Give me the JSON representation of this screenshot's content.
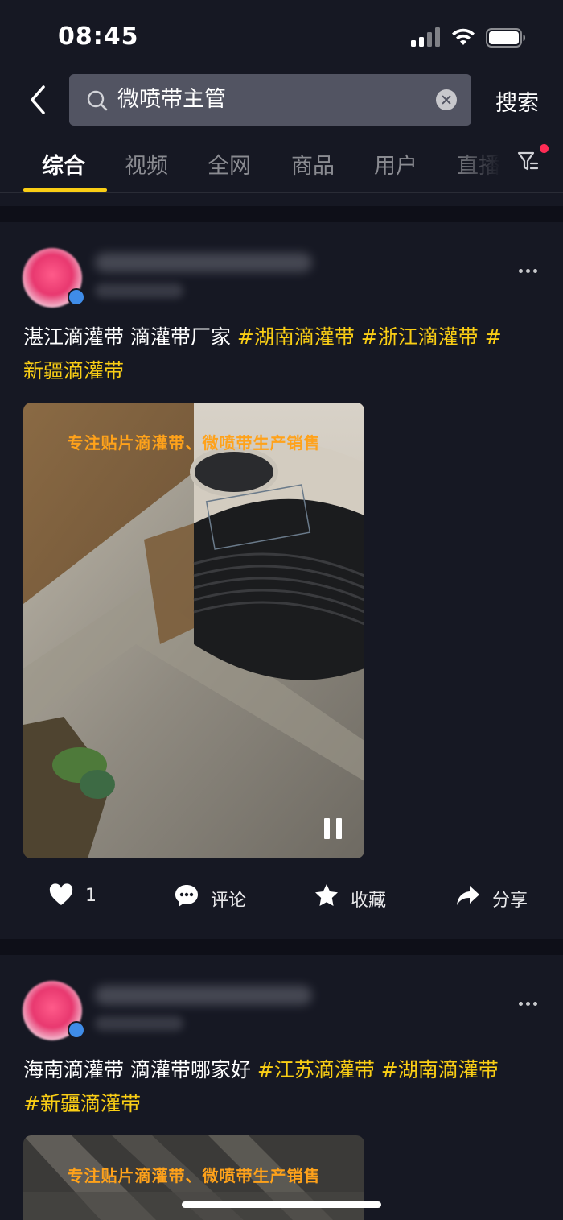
{
  "status_bar": {
    "time": "08:45"
  },
  "search": {
    "query": "微喷带主管",
    "button_label": "搜索"
  },
  "tabs": [
    {
      "label": "综合",
      "active": true
    },
    {
      "label": "视频",
      "active": false
    },
    {
      "label": "全网",
      "active": false
    },
    {
      "label": "商品",
      "active": false
    },
    {
      "label": "用户",
      "active": false
    },
    {
      "label": "直播",
      "active": false
    }
  ],
  "posts": [
    {
      "caption_text": "湛江滴灌带 滴灌带厂家 ",
      "hashtags": [
        "#湖南滴灌带",
        " #浙江滴灌带",
        " #",
        "新疆滴灌带"
      ],
      "video_overlay": "专注贴片滴灌带、微喷带生产销售",
      "actions": {
        "likes": "1",
        "comment": "评论",
        "favorite": "收藏",
        "share": "分享"
      }
    },
    {
      "caption_text": "海南滴灌带 滴灌带哪家好 ",
      "hashtags": [
        "#江苏滴灌带",
        " #湖南滴灌带",
        "#新疆滴灌带"
      ],
      "video_overlay": "专注贴片滴灌带、微喷带生产销售"
    }
  ],
  "colors": {
    "background": "#161823",
    "accent": "#face15",
    "badge": "#fe2c55",
    "overlay_text": "#ffa21a"
  },
  "icons": [
    "back-arrow-icon",
    "search-icon",
    "clear-icon",
    "filter-icon",
    "more-icon",
    "heart-icon",
    "comment-icon",
    "star-icon",
    "share-icon",
    "pause-icon"
  ]
}
